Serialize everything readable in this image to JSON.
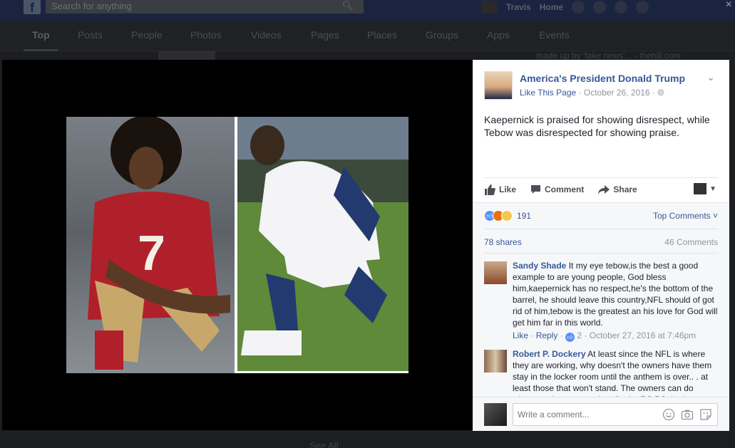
{
  "topbar": {
    "logo": "f",
    "search_placeholder": "Search for anything",
    "user_name": "Travis",
    "home_label": "Home",
    "close_glyph": "×"
  },
  "tabs": [
    "Top",
    "Posts",
    "People",
    "Photos",
    "Videos",
    "Pages",
    "Places",
    "Groups",
    "Apps",
    "Events"
  ],
  "background": {
    "snippet": "made up by 'fake news'... - thehill.com",
    "see_all": "See All"
  },
  "post": {
    "page_name": "America's President Donald Trump",
    "like_page": "Like This Page",
    "date": "October 26, 2016",
    "text": "Kaepernick is praised for showing disrespect, while Tebow was disrespected for showing praise.",
    "actions": {
      "like": "Like",
      "comment": "Comment",
      "share": "Share"
    },
    "reactions_count": "191",
    "top_comments": "Top Comments",
    "shares": "78 shares",
    "comments_count": "46 Comments"
  },
  "comments": [
    {
      "author": "Sandy Shade",
      "text": "It my eye tebow,is the best a good example to are young people, God bless him,kaepernick has no respect,he's the bottom of the barrel, he should leave this country,NFL should of got rid of him,tebow is the greatest an his love for God will get him far in this world.",
      "like": "Like",
      "reply": "Reply",
      "likes": "2",
      "date": "October 27, 2016 at 7:46pm"
    },
    {
      "author": "Robert P. Dockery",
      "text": "At least since the NFL is where they are working, why doesn't the owners have them stay in the locker room until the anthem is over.. . at least those that won't stand. The owners can do whatever they want to handle the PC BS that's"
    }
  ],
  "write_comment": {
    "placeholder": "Write a comment..."
  },
  "colors": {
    "link": "#365899",
    "viewer_bg": "#000000",
    "topbar": "#1a2440"
  }
}
